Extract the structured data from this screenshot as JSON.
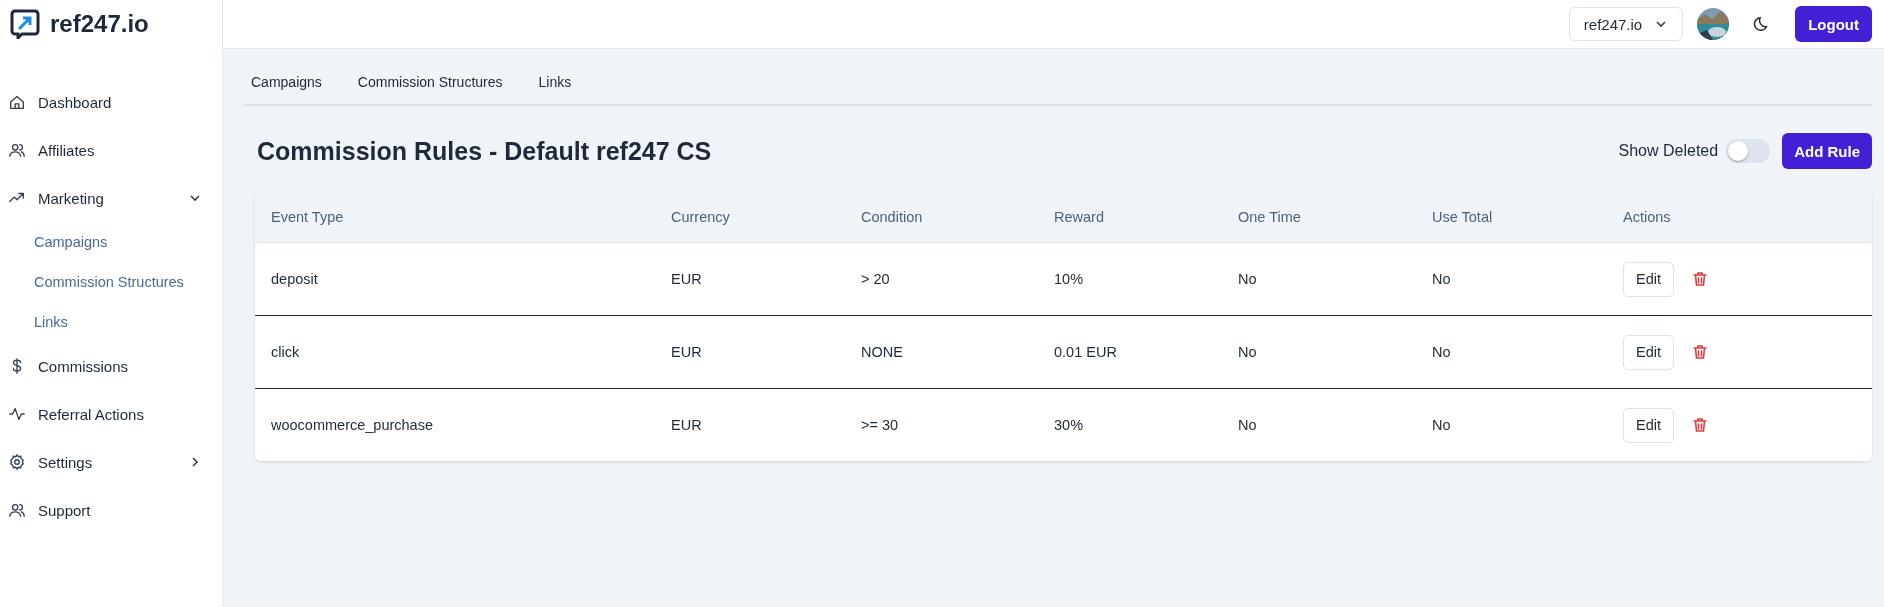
{
  "brand": {
    "name": "ref247.io"
  },
  "sidebar": {
    "items": [
      {
        "label": "Dashboard"
      },
      {
        "label": "Affiliates"
      },
      {
        "label": "Marketing",
        "expanded": true,
        "children": [
          {
            "label": "Campaigns"
          },
          {
            "label": "Commission Structures"
          },
          {
            "label": "Links"
          }
        ]
      },
      {
        "label": "Commissions"
      },
      {
        "label": "Referral Actions"
      },
      {
        "label": "Settings",
        "expanded": false
      },
      {
        "label": "Support"
      }
    ]
  },
  "topbar": {
    "workspace": "ref247.io",
    "logout": "Logout"
  },
  "tabs": [
    {
      "label": "Campaigns"
    },
    {
      "label": "Commission Structures"
    },
    {
      "label": "Links"
    }
  ],
  "page": {
    "title": "Commission Rules - Default ref247 CS",
    "show_deleted": {
      "label": "Show Deleted",
      "on": false
    },
    "add_button": "Add Rule"
  },
  "table": {
    "columns": [
      "Event Type",
      "Currency",
      "Condition",
      "Reward",
      "One Time",
      "Use Total",
      "Actions"
    ],
    "rows": [
      {
        "cells": [
          "deposit",
          "EUR",
          "> 20",
          "10%",
          "No",
          "No"
        ],
        "action": "Edit"
      },
      {
        "cells": [
          "click",
          "EUR",
          "NONE",
          "0.01 EUR",
          "No",
          "No"
        ],
        "action": "Edit"
      },
      {
        "cells": [
          "woocommerce_purchase",
          "EUR",
          ">= 30",
          "30%",
          "No",
          "No"
        ],
        "action": "Edit"
      }
    ]
  }
}
